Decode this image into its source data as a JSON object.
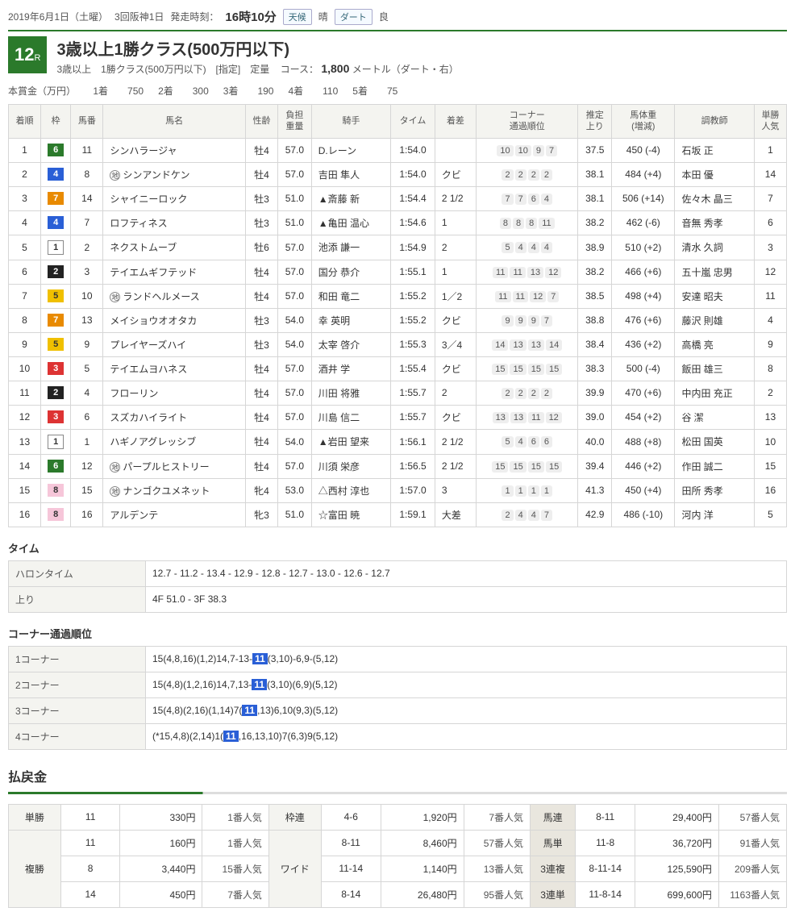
{
  "meta": {
    "date": "2019年6月1日（土曜）",
    "meeting": "3回阪神1日",
    "post_label": "発走時刻：",
    "post_time": "16時10分",
    "weather_label": "天候",
    "weather": "晴",
    "track_label": "ダート",
    "track": "良"
  },
  "race": {
    "number": "12",
    "number_suffix": "R",
    "title": "3歳以上1勝クラス(500万円以下)",
    "condition": "3歳以上　1勝クラス(500万円以下)　[指定]　定量",
    "course_label": "コース：",
    "distance": "1,800",
    "course_suffix": "メートル（ダート・右）"
  },
  "prize": {
    "label": "本賞金（万円）",
    "items": [
      {
        "p": "1着",
        "v": "750"
      },
      {
        "p": "2着",
        "v": "300"
      },
      {
        "p": "3着",
        "v": "190"
      },
      {
        "p": "4着",
        "v": "110"
      },
      {
        "p": "5着",
        "v": "75"
      }
    ]
  },
  "columns": [
    "着順",
    "枠",
    "馬番",
    "馬名",
    "性齢",
    "負担\n重量",
    "騎手",
    "タイム",
    "着差",
    "コーナー\n通過順位",
    "推定\n上り",
    "馬体重\n(増減)",
    "調教師",
    "単勝\n人気"
  ],
  "rows": [
    {
      "rank": "1",
      "waku": "6",
      "num": "11",
      "ji": false,
      "name": "シンハラージャ",
      "sa": "牡4",
      "wt": "57.0",
      "jk": "D.レーン",
      "time": "1:54.0",
      "mg": "",
      "cr": [
        "10",
        "10",
        "9",
        "7"
      ],
      "up": "37.5",
      "bw": "450 (-4)",
      "tr": "石坂 正",
      "pop": "1"
    },
    {
      "rank": "2",
      "waku": "4",
      "num": "8",
      "ji": true,
      "name": "シンアンドケン",
      "sa": "牡4",
      "wt": "57.0",
      "jk": "吉田 隼人",
      "time": "1:54.0",
      "mg": "クビ",
      "cr": [
        "2",
        "2",
        "2",
        "2"
      ],
      "up": "38.1",
      "bw": "484 (+4)",
      "tr": "本田 優",
      "pop": "14"
    },
    {
      "rank": "3",
      "waku": "7",
      "num": "14",
      "ji": false,
      "name": "シャイニーロック",
      "sa": "牡3",
      "wt": "51.0",
      "jk": "▲斎藤 新",
      "time": "1:54.4",
      "mg": "2 1/2",
      "cr": [
        "7",
        "7",
        "6",
        "4"
      ],
      "up": "38.1",
      "bw": "506 (+14)",
      "tr": "佐々木 晶三",
      "pop": "7"
    },
    {
      "rank": "4",
      "waku": "4",
      "num": "7",
      "ji": false,
      "name": "ロフティネス",
      "sa": "牡3",
      "wt": "51.0",
      "jk": "▲亀田 温心",
      "time": "1:54.6",
      "mg": "1",
      "cr": [
        "8",
        "8",
        "8",
        "11"
      ],
      "up": "38.2",
      "bw": "462 (-6)",
      "tr": "音無 秀孝",
      "pop": "6"
    },
    {
      "rank": "5",
      "waku": "1",
      "num": "2",
      "ji": false,
      "name": "ネクストムーブ",
      "sa": "牡6",
      "wt": "57.0",
      "jk": "池添 謙一",
      "time": "1:54.9",
      "mg": "2",
      "cr": [
        "5",
        "4",
        "4",
        "4"
      ],
      "up": "38.9",
      "bw": "510 (+2)",
      "tr": "清水 久詞",
      "pop": "3"
    },
    {
      "rank": "6",
      "waku": "2",
      "num": "3",
      "ji": false,
      "name": "テイエムギフテッド",
      "sa": "牡4",
      "wt": "57.0",
      "jk": "国分 恭介",
      "time": "1:55.1",
      "mg": "1",
      "cr": [
        "11",
        "11",
        "13",
        "12"
      ],
      "up": "38.2",
      "bw": "466 (+6)",
      "tr": "五十嵐 忠男",
      "pop": "12"
    },
    {
      "rank": "7",
      "waku": "5",
      "num": "10",
      "ji": true,
      "name": "ランドヘルメース",
      "sa": "牡4",
      "wt": "57.0",
      "jk": "和田 竜二",
      "time": "1:55.2",
      "mg": "1／2",
      "cr": [
        "11",
        "11",
        "12",
        "7"
      ],
      "up": "38.5",
      "bw": "498 (+4)",
      "tr": "安達 昭夫",
      "pop": "11"
    },
    {
      "rank": "8",
      "waku": "7",
      "num": "13",
      "ji": false,
      "name": "メイショウオオタカ",
      "sa": "牡3",
      "wt": "54.0",
      "jk": "幸 英明",
      "time": "1:55.2",
      "mg": "クビ",
      "cr": [
        "9",
        "9",
        "9",
        "7"
      ],
      "up": "38.8",
      "bw": "476 (+6)",
      "tr": "藤沢 則雄",
      "pop": "4"
    },
    {
      "rank": "9",
      "waku": "5",
      "num": "9",
      "ji": false,
      "name": "プレイヤーズハイ",
      "sa": "牡3",
      "wt": "54.0",
      "jk": "太宰 啓介",
      "time": "1:55.3",
      "mg": "3／4",
      "cr": [
        "14",
        "13",
        "13",
        "14"
      ],
      "up": "38.4",
      "bw": "436 (+2)",
      "tr": "高橋 亮",
      "pop": "9"
    },
    {
      "rank": "10",
      "waku": "3",
      "num": "5",
      "ji": false,
      "name": "テイエムヨハネス",
      "sa": "牡4",
      "wt": "57.0",
      "jk": "酒井 学",
      "time": "1:55.4",
      "mg": "クビ",
      "cr": [
        "15",
        "15",
        "15",
        "15"
      ],
      "up": "38.3",
      "bw": "500 (-4)",
      "tr": "飯田 雄三",
      "pop": "8"
    },
    {
      "rank": "11",
      "waku": "2",
      "num": "4",
      "ji": false,
      "name": "フローリン",
      "sa": "牡4",
      "wt": "57.0",
      "jk": "川田 将雅",
      "time": "1:55.7",
      "mg": "2",
      "cr": [
        "2",
        "2",
        "2",
        "2"
      ],
      "up": "39.9",
      "bw": "470 (+6)",
      "tr": "中内田 充正",
      "pop": "2"
    },
    {
      "rank": "12",
      "waku": "3",
      "num": "6",
      "ji": false,
      "name": "スズカハイライト",
      "sa": "牡4",
      "wt": "57.0",
      "jk": "川島 信二",
      "time": "1:55.7",
      "mg": "クビ",
      "cr": [
        "13",
        "13",
        "11",
        "12"
      ],
      "up": "39.0",
      "bw": "454 (+2)",
      "tr": "谷 潔",
      "pop": "13"
    },
    {
      "rank": "13",
      "waku": "1",
      "num": "1",
      "ji": false,
      "name": "ハギノアグレッシブ",
      "sa": "牡4",
      "wt": "54.0",
      "jk": "▲岩田 望来",
      "time": "1:56.1",
      "mg": "2 1/2",
      "cr": [
        "5",
        "4",
        "6",
        "6"
      ],
      "up": "40.0",
      "bw": "488 (+8)",
      "tr": "松田 国英",
      "pop": "10"
    },
    {
      "rank": "14",
      "waku": "6",
      "num": "12",
      "ji": true,
      "name": "パープルヒストリー",
      "sa": "牡4",
      "wt": "57.0",
      "jk": "川須 栄彦",
      "time": "1:56.5",
      "mg": "2 1/2",
      "cr": [
        "15",
        "15",
        "15",
        "15"
      ],
      "up": "39.4",
      "bw": "446 (+2)",
      "tr": "作田 誠二",
      "pop": "15"
    },
    {
      "rank": "15",
      "waku": "8",
      "num": "15",
      "ji": true,
      "name": "ナンゴクユメネット",
      "sa": "牝4",
      "wt": "53.0",
      "jk": "△西村 淳也",
      "time": "1:57.0",
      "mg": "3",
      "cr": [
        "1",
        "1",
        "1",
        "1"
      ],
      "up": "41.3",
      "bw": "450 (+4)",
      "tr": "田所 秀孝",
      "pop": "16"
    },
    {
      "rank": "16",
      "waku": "8",
      "num": "16",
      "ji": false,
      "name": "アルデンテ",
      "sa": "牝3",
      "wt": "51.0",
      "jk": "☆富田 暁",
      "time": "1:59.1",
      "mg": "大差",
      "cr": [
        "2",
        "4",
        "4",
        "7"
      ],
      "up": "42.9",
      "bw": "486 (-10)",
      "tr": "河内 洋",
      "pop": "5"
    }
  ],
  "lap": {
    "title": "タイム",
    "harontime_label": "ハロンタイム",
    "harontime": "12.7 - 11.2 - 13.4 - 12.9 - 12.8 - 12.7 - 13.0 - 12.6 - 12.7",
    "agari_label": "上り",
    "agari": "4F 51.0 - 3F 38.3"
  },
  "corner": {
    "title": "コーナー通過順位",
    "rows": [
      {
        "label": "1コーナー",
        "v": "15(4,8,16)(1,2)14,7-13-<hl>11</hl>(3,10)-6,9-(5,12)"
      },
      {
        "label": "2コーナー",
        "v": "15(4,8)(1,2,16)14,7,13-<hl>11</hl>(3,10)(6,9)(5,12)"
      },
      {
        "label": "3コーナー",
        "v": "15(4,8)(2,16)(1,14)7(<hl>11</hl>,13)6,10(9,3)(5,12)"
      },
      {
        "label": "4コーナー",
        "v": "(*15,4,8)(2,14)1(<hl>11</hl>,16,13,10)7(6,3)9(5,12)"
      }
    ]
  },
  "payout": {
    "title": "払戻金",
    "rows": [
      [
        "単勝",
        "11",
        "330円",
        "1番人気",
        "枠連",
        "4-6",
        "1,920円",
        "7番人気",
        "馬連",
        "8-11",
        "29,400円",
        "57番人気"
      ],
      [
        "複勝",
        "11",
        "160円",
        "1番人気",
        "ワイド",
        "8-11",
        "8,460円",
        "57番人気",
        "馬単",
        "11-8",
        "36,720円",
        "91番人気"
      ],
      [
        "",
        "8",
        "3,440円",
        "15番人気",
        "",
        "11-14",
        "1,140円",
        "13番人気",
        "3連複",
        "8-11-14",
        "125,590円",
        "209番人気"
      ],
      [
        "",
        "14",
        "450円",
        "7番人気",
        "",
        "8-14",
        "26,480円",
        "95番人気",
        "3連単",
        "11-8-14",
        "699,600円",
        "1163番人気"
      ]
    ]
  }
}
